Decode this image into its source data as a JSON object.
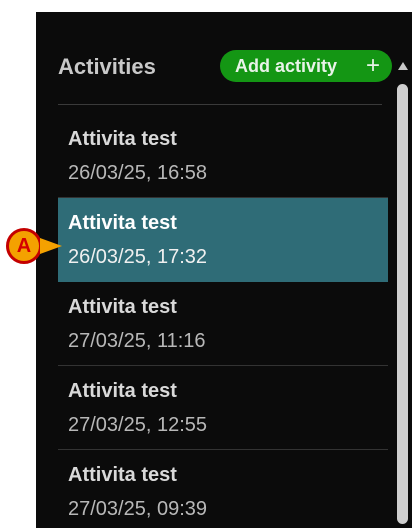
{
  "header": {
    "title": "Activities",
    "add_button_label": "Add activity",
    "add_button_icon": "+"
  },
  "activities": [
    {
      "name": "Attivita test",
      "datetime": "26/03/25, 16:58"
    },
    {
      "name": "Attivita test",
      "datetime": "26/03/25, 17:32"
    },
    {
      "name": "Attivita test",
      "datetime": "27/03/25, 11:16"
    },
    {
      "name": "Attivita test",
      "datetime": "27/03/25, 12:55"
    },
    {
      "name": "Attivita test",
      "datetime": "27/03/25, 09:39"
    }
  ],
  "callout": {
    "label": "A"
  },
  "colors": {
    "panel_bg": "#0b0b0b",
    "accent_green": "#149614",
    "selected_row": "#2f6c77",
    "callout_fill": "#f4a100",
    "callout_border": "#c40000"
  }
}
